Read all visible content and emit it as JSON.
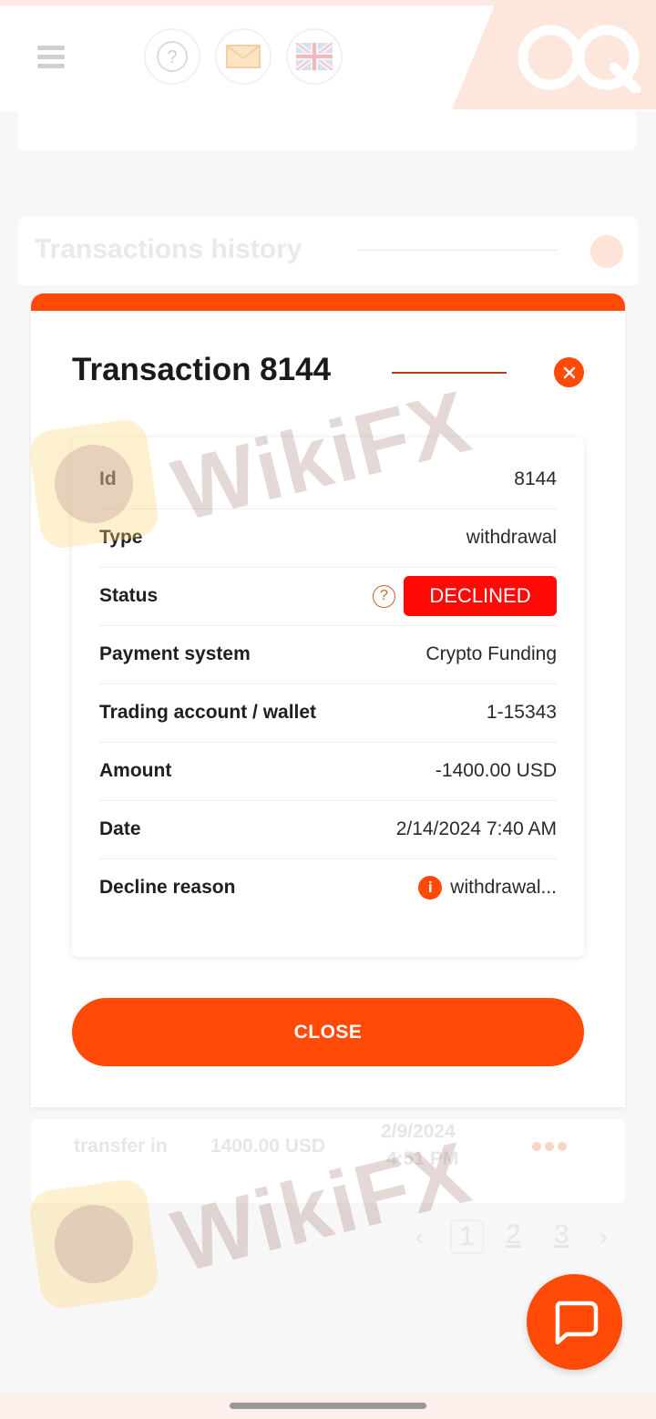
{
  "header": {
    "icons": [
      "menu-icon",
      "help-icon",
      "mail-icon",
      "uk-flag-icon"
    ],
    "logo": "OQ"
  },
  "background": {
    "section_title": "Transactions history",
    "row": {
      "type": "transfer in",
      "amount": "1400.00 USD",
      "date": "2/9/2024",
      "time": "4:51 PM"
    },
    "pagination": {
      "prev": "‹",
      "pages": [
        "1",
        "2",
        "3"
      ],
      "next": "›"
    }
  },
  "modal": {
    "title": "Transaction 8144",
    "rows": [
      {
        "label": "Id",
        "value": "8144"
      },
      {
        "label": "Type",
        "value": "withdrawal"
      },
      {
        "label": "Status",
        "value": "DECLINED"
      },
      {
        "label": "Payment system",
        "value": "Crypto Funding"
      },
      {
        "label": "Trading account / wallet",
        "value": "1-15343"
      },
      {
        "label": "Amount",
        "value": "-1400.00 USD"
      },
      {
        "label": "Date",
        "value": "2/14/2024 7:40 AM"
      },
      {
        "label": "Decline reason",
        "value": "withdrawal..."
      }
    ],
    "close_label": "CLOSE",
    "help_glyph": "?",
    "info_glyph": "i"
  },
  "watermark": {
    "text": "WikiFX"
  },
  "colors": {
    "accent": "#ff4a08",
    "declined": "#ff0a07"
  }
}
